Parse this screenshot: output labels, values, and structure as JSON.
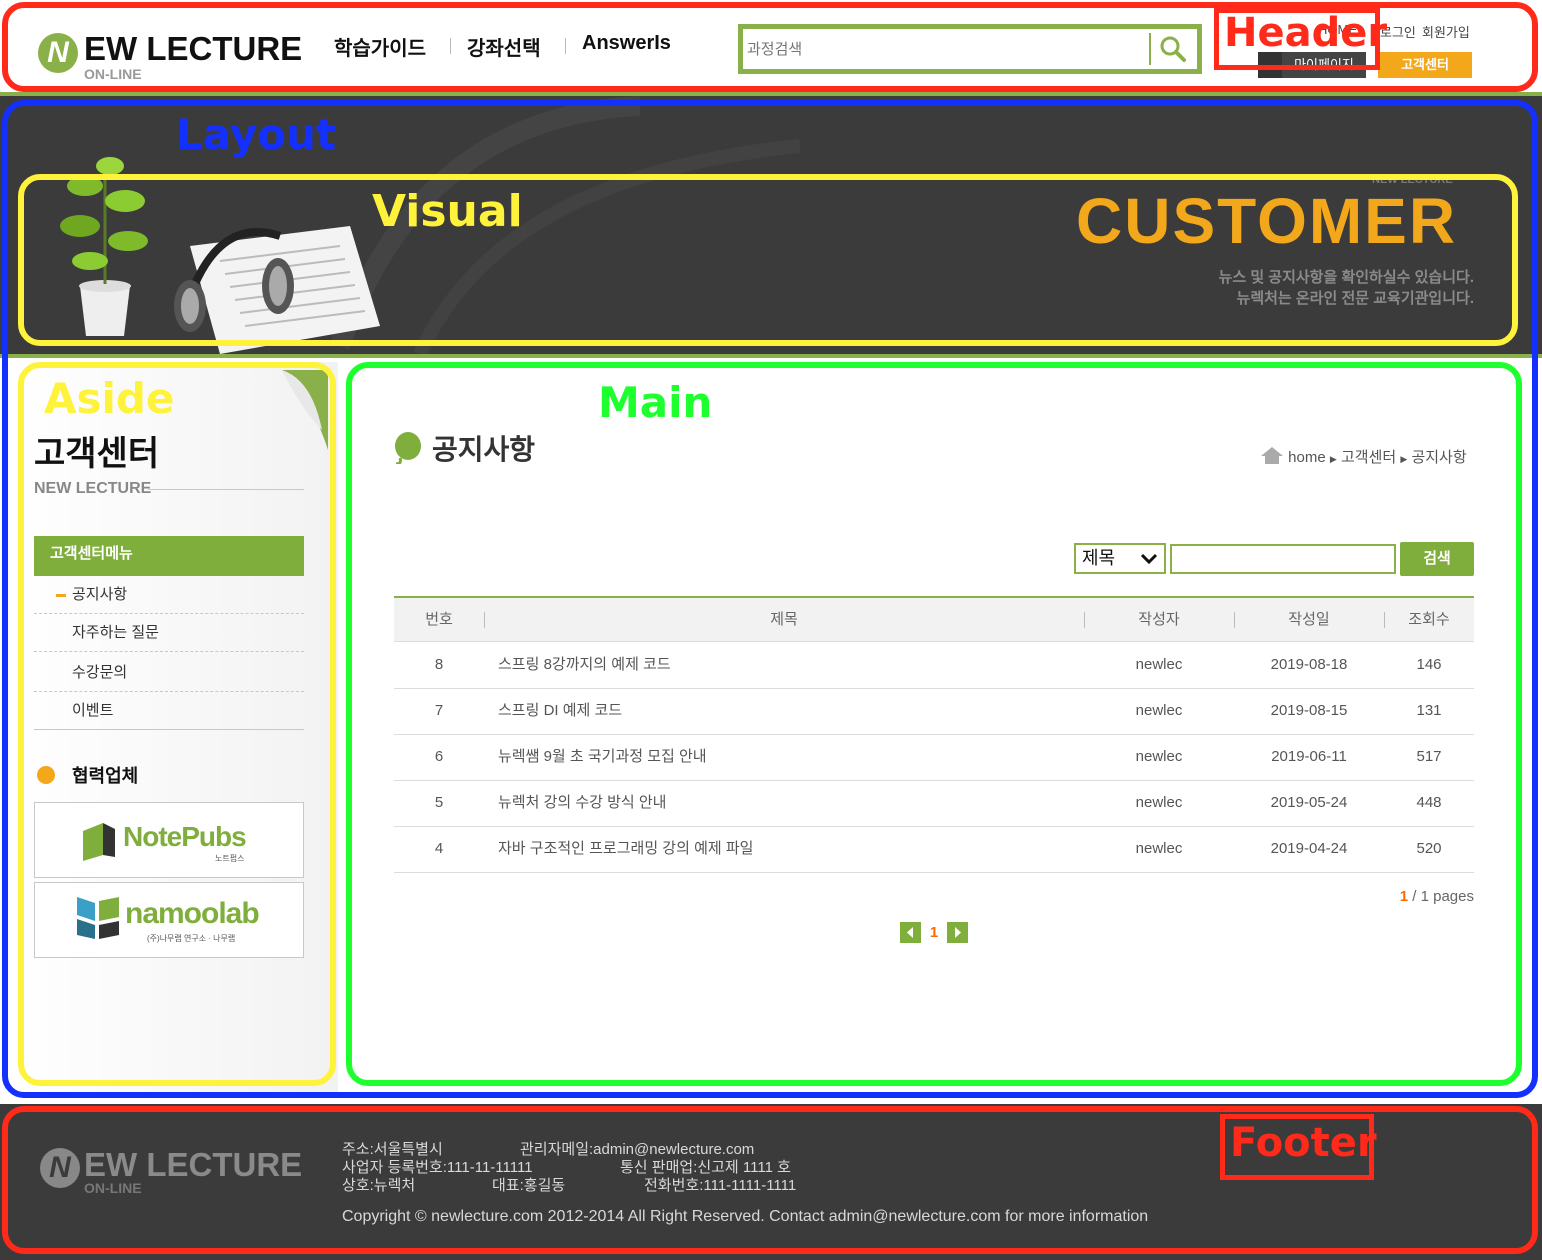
{
  "header": {
    "logo_text": "EW LECTURE",
    "logo_sub": "ON-LINE",
    "logo_letter": "N",
    "nav": [
      "학습가이드",
      "강좌선택",
      "AnswerIs"
    ],
    "search_placeholder": "과정검색",
    "top_links": [
      "HOME",
      "로그인",
      "회원가입"
    ],
    "buttons": [
      "마이페이지",
      "고객센터"
    ]
  },
  "visual": {
    "headline": "CUSTOMER",
    "small_title": "NEW LECTURE",
    "desc_line1": "뉴스 및 공지사항을 확인하실수 있습니다.",
    "desc_line2": "뉴렉처는 온라인 전문 교육기관입니다."
  },
  "aside": {
    "title": "고객센터",
    "subtitle": "NEW LECTURE",
    "menu_title": "고객센터메뉴",
    "menu": [
      "공지사항",
      "자주하는 질문",
      "수강문의",
      "이벤트"
    ],
    "partner_title": "협력업체",
    "partners": [
      {
        "name": "NotePubs",
        "sub": "노트펍스"
      },
      {
        "name": "namoolab",
        "sub": "(주)나무랩 연구소 · 나무랩"
      }
    ]
  },
  "main": {
    "title": "공지사항",
    "breadcrumb": [
      "home",
      "고객센터",
      "공지사항"
    ],
    "search_field": "제목",
    "search_button": "검색",
    "columns": [
      "번호",
      "제목",
      "작성자",
      "작성일",
      "조회수"
    ],
    "rows": [
      {
        "no": "8",
        "title": "스프링 8강까지의 예제 코드",
        "writer": "newlec",
        "date": "2019-08-18",
        "hits": "146"
      },
      {
        "no": "7",
        "title": "스프링 DI 예제 코드",
        "writer": "newlec",
        "date": "2019-08-15",
        "hits": "131"
      },
      {
        "no": "6",
        "title": "뉴렉쌤 9월 초 국기과정 모집 안내",
        "writer": "newlec",
        "date": "2019-06-11",
        "hits": "517"
      },
      {
        "no": "5",
        "title": "뉴렉처 강의 수강 방식 안내",
        "writer": "newlec",
        "date": "2019-05-24",
        "hits": "448"
      },
      {
        "no": "4",
        "title": "자바 구조적인 프로그래밍 강의 예제 파일",
        "writer": "newlec",
        "date": "2019-04-24",
        "hits": "520"
      }
    ],
    "page_current": "1",
    "page_total_text": "/ 1 pages",
    "pager_current": "1"
  },
  "footer": {
    "logo_text": "EW LECTURE",
    "logo_sub": "ON-LINE",
    "logo_letter": "N",
    "address": "주소:서울특별시",
    "admin_email": "관리자메일:admin@newlecture.com",
    "biz_no": "사업자 등록번호:111-11-11111",
    "telecom": "통신 판매업:신고제 1111 호",
    "company": "상호:뉴렉처",
    "ceo": "대표:홍길동",
    "phone": "전화번호:111-1111-1111",
    "copyright": "Copyright © newlecture.com 2012-2014 All Right Reserved. Contact admin@newlecture.com for more information"
  },
  "annotations": {
    "header": "Header",
    "layout": "Layout",
    "visual": "Visual",
    "aside": "Aside",
    "main": "Main",
    "footer": "Footer"
  },
  "colors": {
    "accent_green": "#8ab04a",
    "accent_orange": "#f3a81c",
    "dark_bg": "#3b3b3b",
    "frame_red": "#ff2a1a",
    "frame_blue": "#1430ff",
    "frame_yellow": "#fff23a",
    "frame_green": "#1eff2e"
  }
}
